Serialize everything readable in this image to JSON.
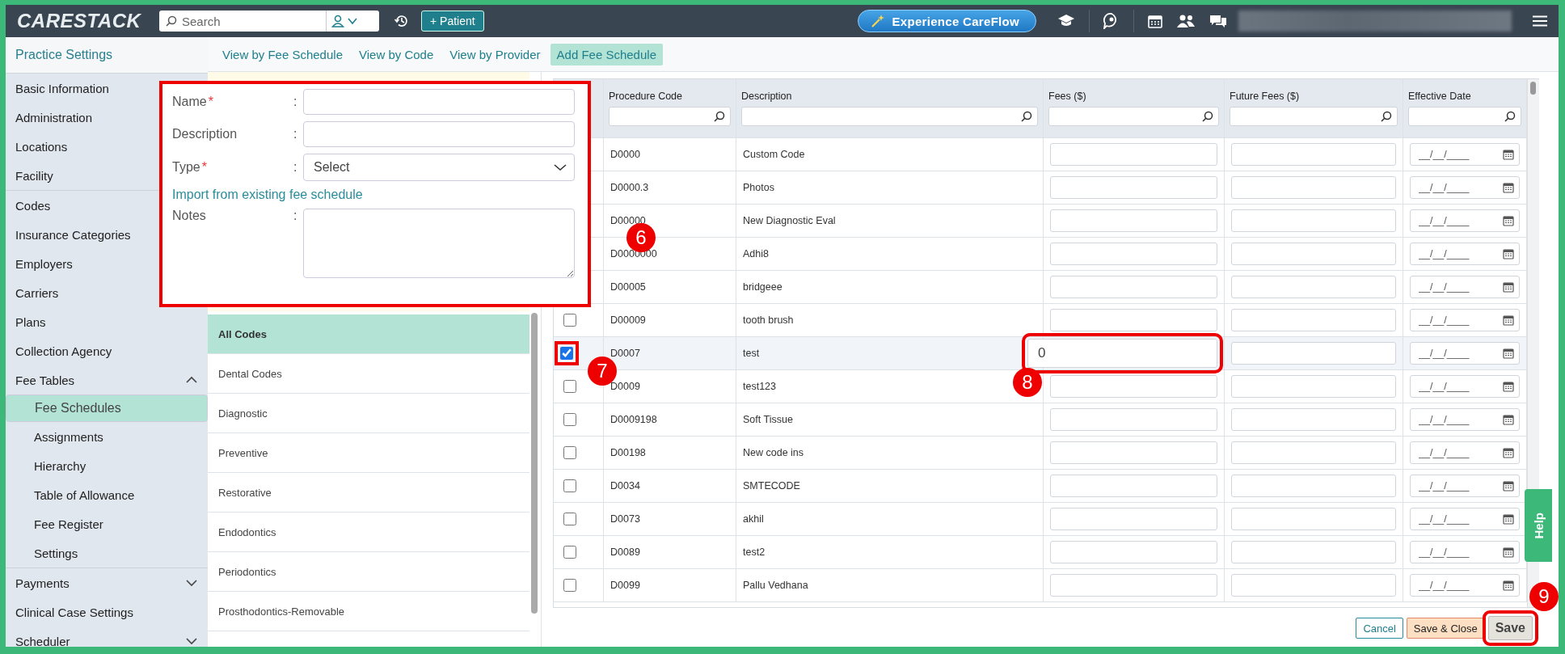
{
  "topbar": {
    "logo": "CARESTACK",
    "search_placeholder": "Search",
    "patient_button": "+ Patient",
    "careflow_button": "Experience CareFlow"
  },
  "sidebar": {
    "title": "Practice Settings",
    "groups": [
      [
        {
          "label": "Basic Information",
          "selected": false
        },
        {
          "label": "Administration",
          "selected": false
        },
        {
          "label": "Locations",
          "selected": false
        },
        {
          "label": "Facility",
          "selected": false
        }
      ],
      [
        {
          "label": "Codes",
          "selected": false
        },
        {
          "label": "Insurance Categories",
          "selected": false
        },
        {
          "label": "Employers",
          "selected": false
        },
        {
          "label": "Carriers",
          "selected": false
        },
        {
          "label": "Plans",
          "selected": false
        },
        {
          "label": "Collection Agency",
          "selected": false
        },
        {
          "label": "Fee Tables",
          "selected": false,
          "expanded": true,
          "children": [
            {
              "label": "Fee Schedules",
              "selected": true
            },
            {
              "label": "Assignments",
              "selected": false
            },
            {
              "label": "Hierarchy",
              "selected": false
            },
            {
              "label": "Table of Allowance",
              "selected": false
            },
            {
              "label": "Fee Register",
              "selected": false
            },
            {
              "label": "Settings",
              "selected": false
            }
          ]
        }
      ],
      [
        {
          "label": "Payments",
          "selected": false,
          "expanded": false
        },
        {
          "label": "Clinical Case Settings",
          "selected": false
        },
        {
          "label": "Scheduler",
          "selected": false,
          "expanded": false
        }
      ]
    ]
  },
  "tabs": [
    {
      "label": "View by Fee Schedule",
      "selected": false
    },
    {
      "label": "View by Code",
      "selected": false
    },
    {
      "label": "View by Provider",
      "selected": false
    },
    {
      "label": "Add Fee Schedule",
      "selected": true
    }
  ],
  "form": {
    "callout": "6",
    "fields": [
      {
        "kind": "input",
        "label": "Name",
        "required_mark": "*",
        "colon": ":"
      },
      {
        "kind": "input",
        "label": "Description",
        "colon": ":"
      },
      {
        "kind": "select",
        "label": "Type",
        "required_mark": "*",
        "colon": ":",
        "value": "Select"
      },
      {
        "kind": "link",
        "label": "Import from existing fee schedule"
      },
      {
        "kind": "textarea",
        "label": "Notes",
        "colon": ":"
      }
    ]
  },
  "categories": [
    {
      "label": "All Codes",
      "selected": true
    },
    {
      "label": "Dental Codes",
      "selected": false
    },
    {
      "label": "Diagnostic",
      "selected": false
    },
    {
      "label": "Preventive",
      "selected": false
    },
    {
      "label": "Restorative",
      "selected": false
    },
    {
      "label": "Endodontics",
      "selected": false
    },
    {
      "label": "Periodontics",
      "selected": false
    },
    {
      "label": "Prosthodontics-Removable",
      "selected": false
    }
  ],
  "table": {
    "columns": [
      "Procedure Code",
      "Description",
      "Fees ($)",
      "Future Fees ($)",
      "Effective Date"
    ],
    "rows": [
      {
        "code": "D0000",
        "description": "Custom Code",
        "date_placeholder": "__/__/____"
      },
      {
        "code": "D0000.3",
        "description": "Photos",
        "date_placeholder": "__/__/____"
      },
      {
        "code": "D00000",
        "description": "New Diagnostic Eval",
        "date_placeholder": "__/__/____"
      },
      {
        "code": "D0000000",
        "description": "Adhi8",
        "date_placeholder": "__/__/____"
      },
      {
        "code": "D00005",
        "description": "bridgeee",
        "date_placeholder": "__/__/____"
      },
      {
        "code": "D00009",
        "description": "tooth brush",
        "checked": false,
        "date_placeholder": "__/__/____"
      },
      {
        "code": "D0007",
        "description": "test",
        "checked": true,
        "checkbox_callout": "7",
        "fees": "0",
        "fees_callout": "8",
        "date_placeholder": "__/__/____"
      },
      {
        "code": "D0009",
        "description": "test123",
        "checked": false,
        "date_placeholder": "__/__/____"
      },
      {
        "code": "D0009198",
        "description": "Soft Tissue",
        "checked": false,
        "date_placeholder": "__/__/____"
      },
      {
        "code": "D00198",
        "description": "New code ins",
        "checked": false,
        "date_placeholder": "__/__/____"
      },
      {
        "code": "D0034",
        "description": "SMTECODE",
        "checked": false,
        "date_placeholder": "__/__/____"
      },
      {
        "code": "D0073",
        "description": "akhil",
        "checked": false,
        "date_placeholder": "__/__/____"
      },
      {
        "code": "D0089",
        "description": "test2",
        "checked": false,
        "date_placeholder": "__/__/____"
      },
      {
        "code": "D0099",
        "description": "Pallu Vedhana",
        "checked": false,
        "date_placeholder": "__/__/____"
      }
    ]
  },
  "buttons": [
    {
      "kind": "cancel",
      "label": "Cancel"
    },
    {
      "kind": "save_close",
      "label": "Save & Close"
    },
    {
      "kind": "save",
      "label": "Save",
      "callout": "9"
    }
  ],
  "help": "Help"
}
